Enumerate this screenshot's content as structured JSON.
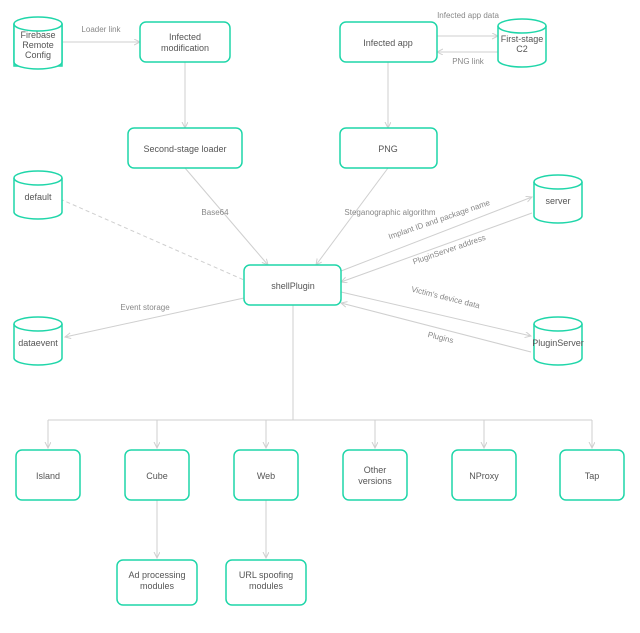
{
  "diagram": {
    "nodes": {
      "firebase": {
        "label1": "Firebase",
        "label2": "Remote",
        "label3": "Config"
      },
      "default": {
        "label": "default"
      },
      "dataevent": {
        "label": "dataevent"
      },
      "server": {
        "label": "server"
      },
      "pluginserver": {
        "label": "PluginServer"
      },
      "firststage": {
        "label1": "First-stage",
        "label2": "C2"
      },
      "infectedmod": {
        "label1": "Infected",
        "label2": "modification"
      },
      "infectedapp": {
        "label": "Infected app"
      },
      "secondstage": {
        "label": "Second-stage loader"
      },
      "png": {
        "label": "PNG"
      },
      "shellplugin": {
        "label": "shellPlugin"
      },
      "island": {
        "label": "Island"
      },
      "cube": {
        "label": "Cube"
      },
      "web": {
        "label": "Web"
      },
      "otherver": {
        "label1": "Other",
        "label2": "versions"
      },
      "nproxy": {
        "label": "NProxy"
      },
      "tap": {
        "label": "Tap"
      },
      "adproc": {
        "label1": "Ad processing",
        "label2": "modules"
      },
      "urlspoof": {
        "label1": "URL spoofing",
        "label2": "modules"
      }
    },
    "edges": {
      "loaderlink": "Loader link",
      "infappdata": "Infected app data",
      "pnglink": "PNG link",
      "base64": "Base64",
      "stego": "Steganographic algorithm",
      "implant": "Implant ID and package name",
      "psaddr": "PluginServer address",
      "victim": "Victim's device data",
      "plugins": "Plugins",
      "eventstore": "Event storage"
    }
  }
}
